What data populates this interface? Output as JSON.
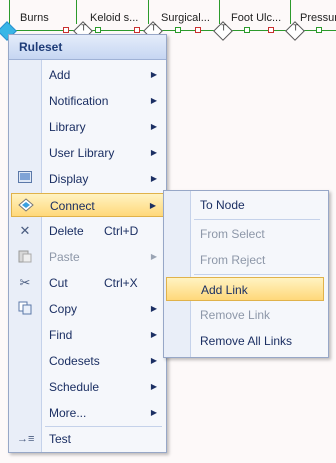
{
  "canvas": {
    "nodes": [
      {
        "label": "Burns"
      },
      {
        "label": "Keloid s..."
      },
      {
        "label": "Surgical..."
      },
      {
        "label": "Foot Ulc..."
      },
      {
        "label": "Pressur"
      }
    ],
    "gate_letter": "T"
  },
  "menu": {
    "title": "Ruleset",
    "items": [
      {
        "label": "Add",
        "icon": "none",
        "submenu": true
      },
      {
        "label": "Notification",
        "icon": "none",
        "submenu": true
      },
      {
        "label": "Library",
        "icon": "none",
        "submenu": true
      },
      {
        "label": "User Library",
        "icon": "none",
        "submenu": true
      },
      {
        "label": "Display",
        "icon": "display-icon",
        "submenu": true
      },
      {
        "label": "Connect",
        "icon": "connect-icon",
        "submenu": true,
        "state": "highlighted"
      },
      {
        "label": "Delete",
        "shortcut": "Ctrl+D",
        "icon": "delete-x-icon"
      },
      {
        "label": "Paste",
        "icon": "paste-icon",
        "submenu": true,
        "state": "disabled"
      },
      {
        "label": "Cut",
        "shortcut": "Ctrl+X",
        "icon": "cut-scissors-icon"
      },
      {
        "label": "Copy",
        "icon": "copy-icon",
        "submenu": true
      },
      {
        "label": "Find",
        "icon": "none",
        "submenu": true
      },
      {
        "label": "Codesets",
        "icon": "none",
        "submenu": true
      },
      {
        "label": "Schedule",
        "icon": "none",
        "submenu": true
      },
      {
        "label": "More...",
        "icon": "none",
        "submenu": true
      },
      {
        "label": "Test",
        "icon": "test-icon"
      }
    ]
  },
  "submenu": {
    "items": [
      {
        "label": "To Node"
      },
      {
        "label": "From Select",
        "state": "disabled"
      },
      {
        "label": "From Reject",
        "state": "disabled"
      },
      {
        "label": "Add Link",
        "state": "highlighted"
      },
      {
        "label": "Remove Link",
        "state": "disabled"
      },
      {
        "label": "Remove All Links"
      }
    ]
  },
  "colors": {
    "highlight": "#ffd87a",
    "menu_text": "#1b2f63",
    "disabled_text": "#8d97a8",
    "port_green": "#2c9a2c",
    "port_red": "#c93030"
  }
}
